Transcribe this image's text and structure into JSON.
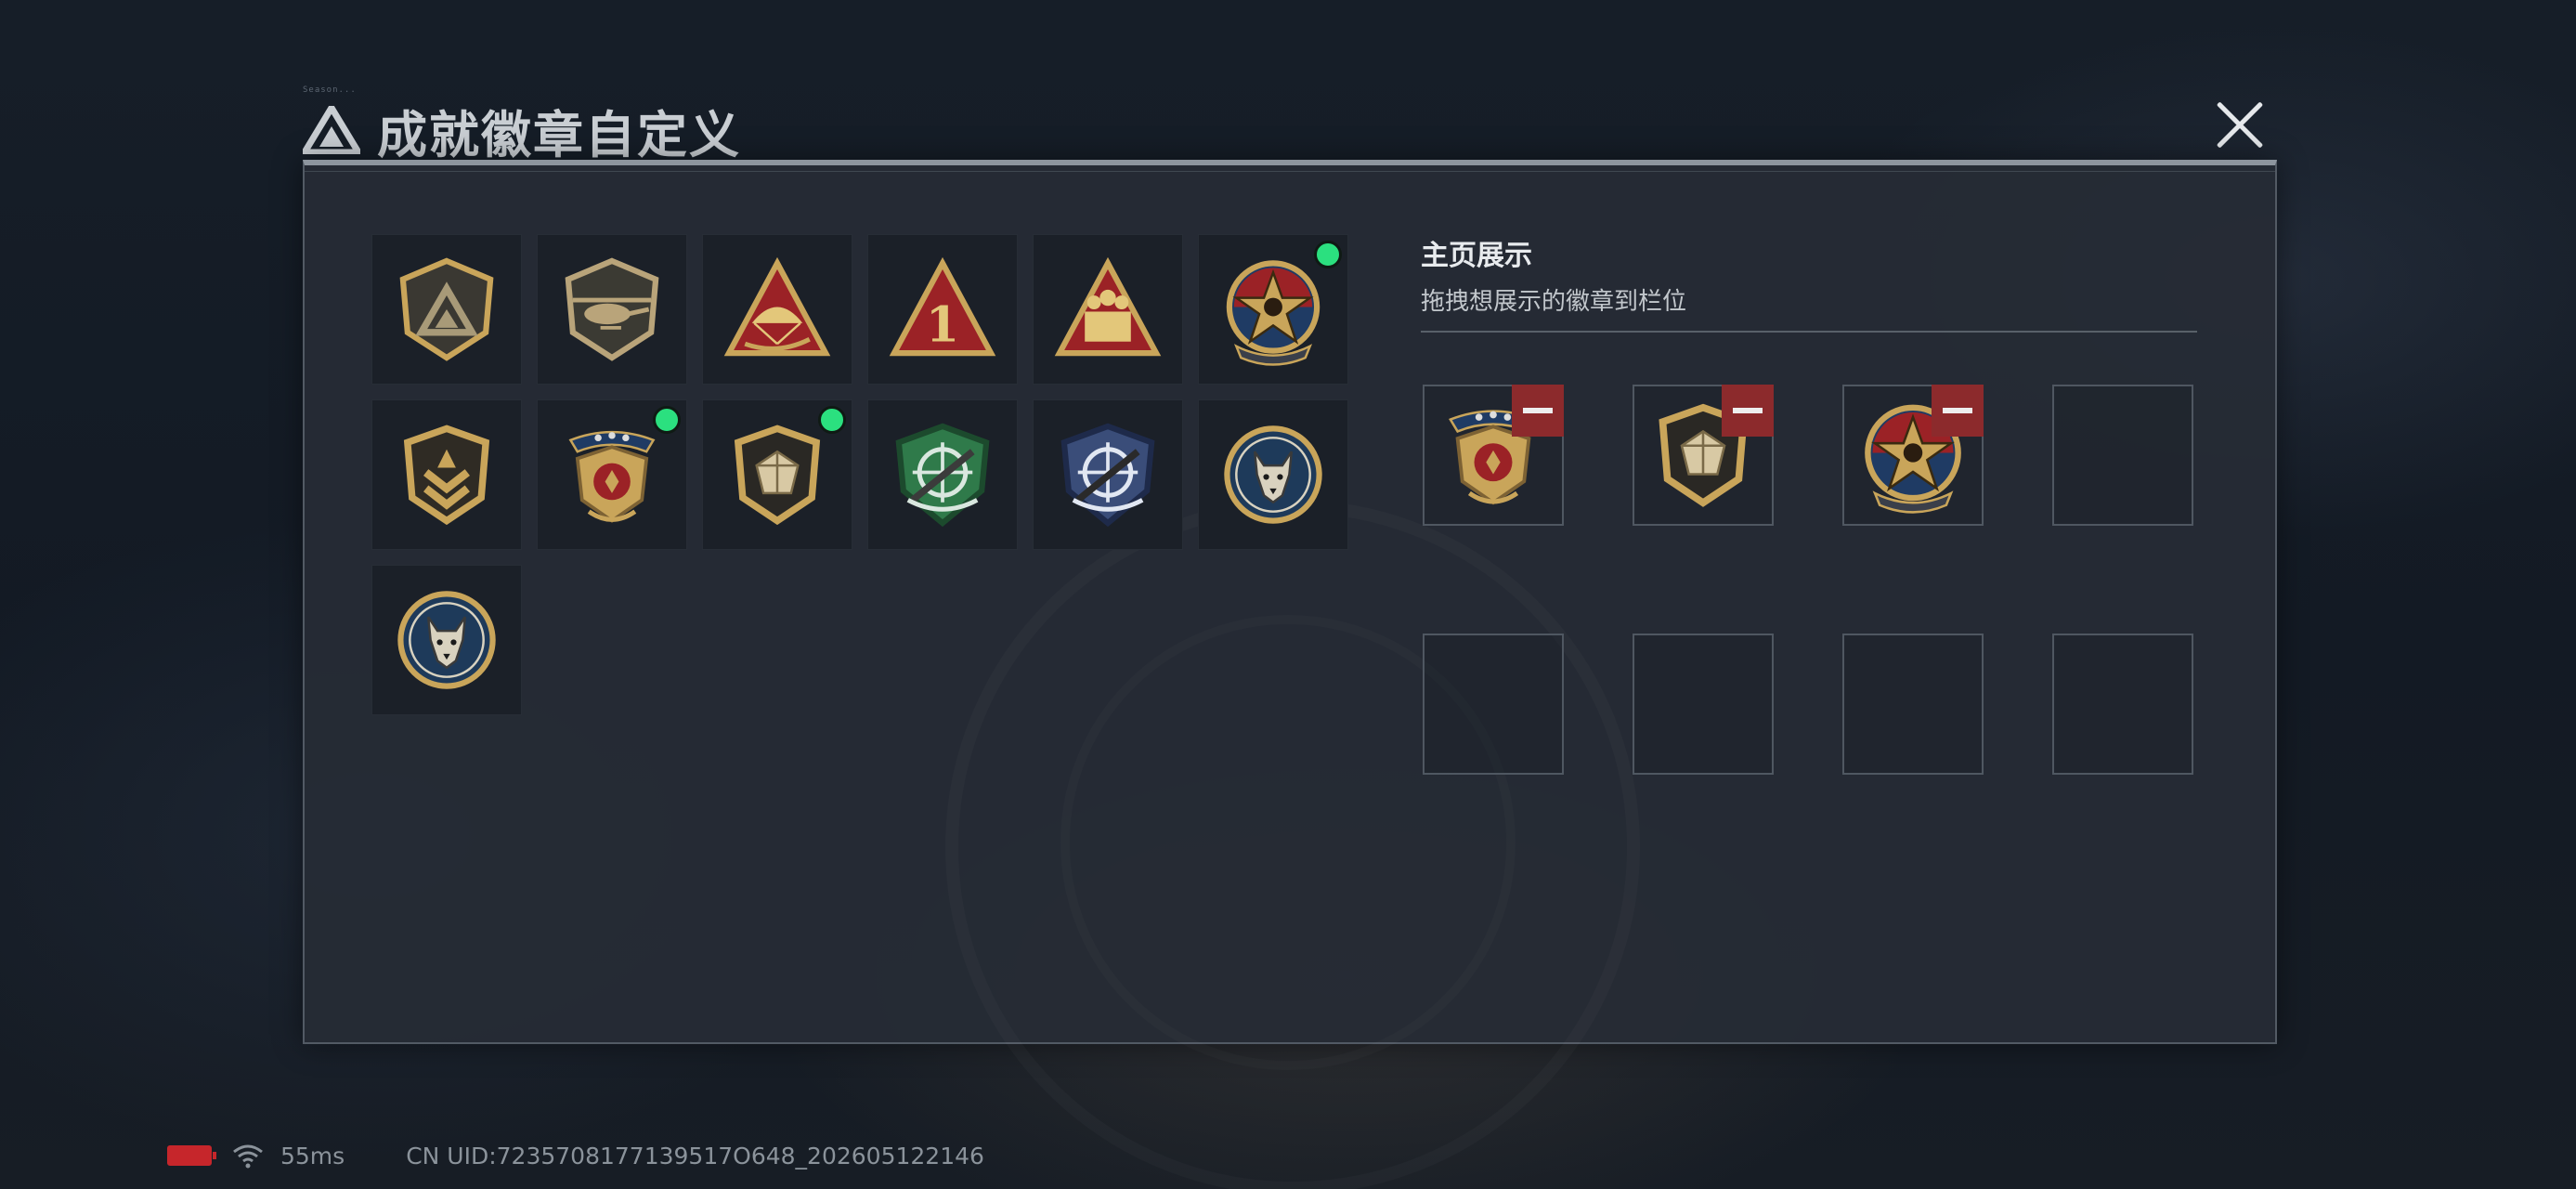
{
  "header": {
    "title": "成就徽章自定义",
    "tiny_text": "Season..."
  },
  "display": {
    "title": "主页展示",
    "subtitle": "拖拽想展示的徽章到栏位"
  },
  "badges": [
    {
      "icon": "mountain-shield-badge-icon",
      "new": false
    },
    {
      "icon": "helicopter-shield-badge-icon",
      "new": false
    },
    {
      "icon": "parachute-triangle-badge-icon",
      "new": false
    },
    {
      "icon": "number-one-triangle-badge-icon",
      "new": false
    },
    {
      "icon": "soldiers-triangle-badge-icon",
      "new": false
    },
    {
      "icon": "star-roundel-badge-icon",
      "new": true
    },
    {
      "icon": "chevron-shield-badge-icon",
      "new": false
    },
    {
      "icon": "winged-shield-badge-icon",
      "new": true
    },
    {
      "icon": "gem-shield-badge-icon",
      "new": true
    },
    {
      "icon": "green-sniper-badge-icon",
      "new": false
    },
    {
      "icon": "blue-sniper-badge-icon",
      "new": false
    },
    {
      "icon": "wolf-roundel-badge-icon",
      "new": false
    },
    {
      "icon": "wolf-roundel-badge-icon",
      "new": false
    }
  ],
  "slots": [
    {
      "icon": "winged-shield-badge-icon",
      "filled": true
    },
    {
      "icon": "gem-shield-badge-icon",
      "filled": true
    },
    {
      "icon": "star-roundel-badge-icon",
      "filled": true
    },
    {
      "icon": "",
      "filled": false
    },
    {
      "icon": "",
      "filled": false
    },
    {
      "icon": "",
      "filled": false
    },
    {
      "icon": "",
      "filled": false
    },
    {
      "icon": "",
      "filled": false
    }
  ],
  "status": {
    "ping": "55ms",
    "uid": "CN UID:7235708177139517O648_202605122146"
  },
  "colors": {
    "accent_green": "#2be07f",
    "remove_red": "#8c2a2c",
    "gold": "#c9a55a"
  }
}
